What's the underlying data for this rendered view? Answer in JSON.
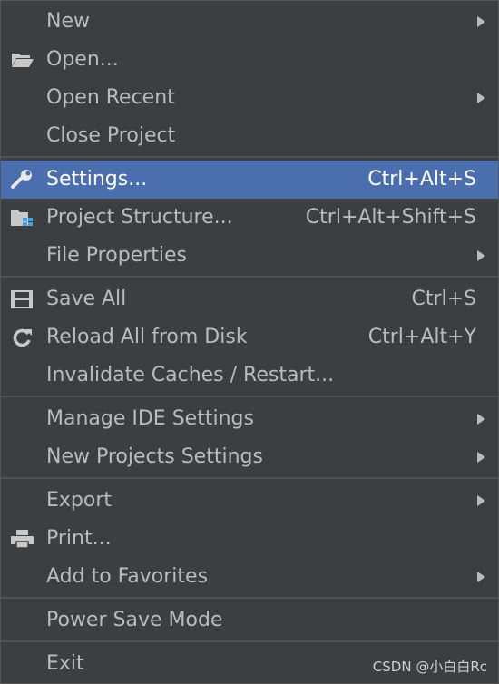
{
  "menu": {
    "new": "New",
    "open": "Open...",
    "open_recent": "Open Recent",
    "close_project": "Close Project",
    "settings": "Settings...",
    "settings_shortcut": "Ctrl+Alt+S",
    "project_structure": "Project Structure...",
    "project_structure_shortcut": "Ctrl+Alt+Shift+S",
    "file_properties": "File Properties",
    "save_all": "Save All",
    "save_all_shortcut": "Ctrl+S",
    "reload_all": "Reload All from Disk",
    "reload_all_shortcut": "Ctrl+Alt+Y",
    "invalidate_caches": "Invalidate Caches / Restart...",
    "manage_ide_settings": "Manage IDE Settings",
    "new_projects_settings": "New Projects Settings",
    "export": "Export",
    "print": "Print...",
    "add_to_favorites": "Add to Favorites",
    "power_save_mode": "Power Save Mode",
    "exit": "Exit"
  },
  "watermark": "CSDN @小白白Rc",
  "colors": {
    "background": "#3c3f41",
    "selected": "#4b6eaf",
    "text": "#bbbbbb",
    "separator": "#515151"
  },
  "icons": {
    "open": "folder-open-icon",
    "settings": "wrench-icon",
    "project_structure": "project-structure-icon",
    "save_all": "save-icon",
    "reload_all": "reload-icon",
    "print": "print-icon"
  }
}
